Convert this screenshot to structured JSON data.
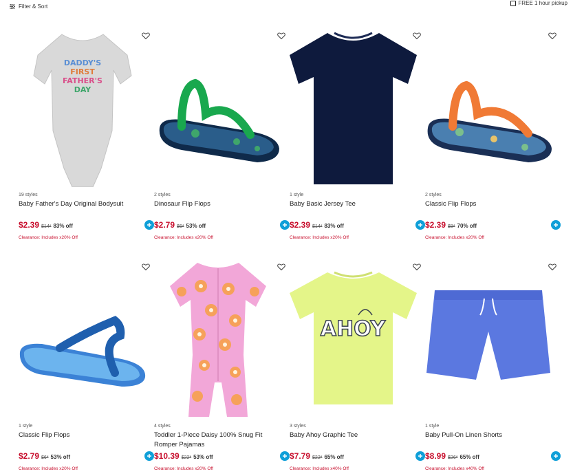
{
  "toolbar": {
    "filter_label": "Filter & Sort",
    "pickup_label": "FREE 1 hour pickup"
  },
  "colors": {
    "sale": "#c8102e",
    "add_button": "#0f9fd8"
  },
  "products": [
    {
      "styles": "19 styles",
      "name": "Baby Father's Day Original Bodysuit",
      "price": "$2.39",
      "original": "$14*",
      "off": "83% off",
      "clearance": "Clearance: Includes x20% Off",
      "image_icon": "bodysuit"
    },
    {
      "styles": "2 styles",
      "name": "Dinosaur Flip Flops",
      "price": "$2.79",
      "original": "$6*",
      "off": "53% off",
      "clearance": "Clearance: Includes x20% Off",
      "image_icon": "flipflop-green"
    },
    {
      "styles": "1 style",
      "name": "Baby Basic Jersey Tee",
      "price": "$2.39",
      "original": "$14*",
      "off": "83% off",
      "clearance": "Clearance: Includes x20% Off",
      "image_icon": "tee-navy"
    },
    {
      "styles": "2 styles",
      "name": "Classic Flip Flops",
      "price": "$2.39",
      "original": "$8*",
      "off": "70% off",
      "clearance": "Clearance: Includes x20% Off",
      "image_icon": "flipflop-orange"
    },
    {
      "styles": "1 style",
      "name": "Classic Flip Flops",
      "price": "$2.79",
      "original": "$6*",
      "off": "53% off",
      "clearance": "Clearance: Includes x20% Off",
      "image_icon": "flipflop-blue"
    },
    {
      "styles": "4 styles",
      "name": "Toddler 1-Piece Daisy 100% Snug Fit Romper Pajamas",
      "price": "$10.39",
      "original": "$22*",
      "off": "53% off",
      "clearance": "Clearance: Includes x20% Off",
      "image_icon": "romper-pink"
    },
    {
      "styles": "3 styles",
      "name": "Baby Ahoy Graphic Tee",
      "price": "$7.79",
      "original": "$22*",
      "off": "65% off",
      "clearance": "Clearance: Includes x40% Off",
      "image_icon": "tee-lime"
    },
    {
      "styles": "1 style",
      "name": "Baby Pull-On Linen Shorts",
      "price": "$8.99",
      "original": "$26*",
      "off": "65% off",
      "clearance": "Clearance: Includes x40% Off",
      "image_icon": "shorts-blue"
    }
  ],
  "bodysuit_print": [
    "DADDY'S",
    "FIRST",
    "FATHER'S",
    "DAY"
  ],
  "ahoy_print": "AHOY"
}
